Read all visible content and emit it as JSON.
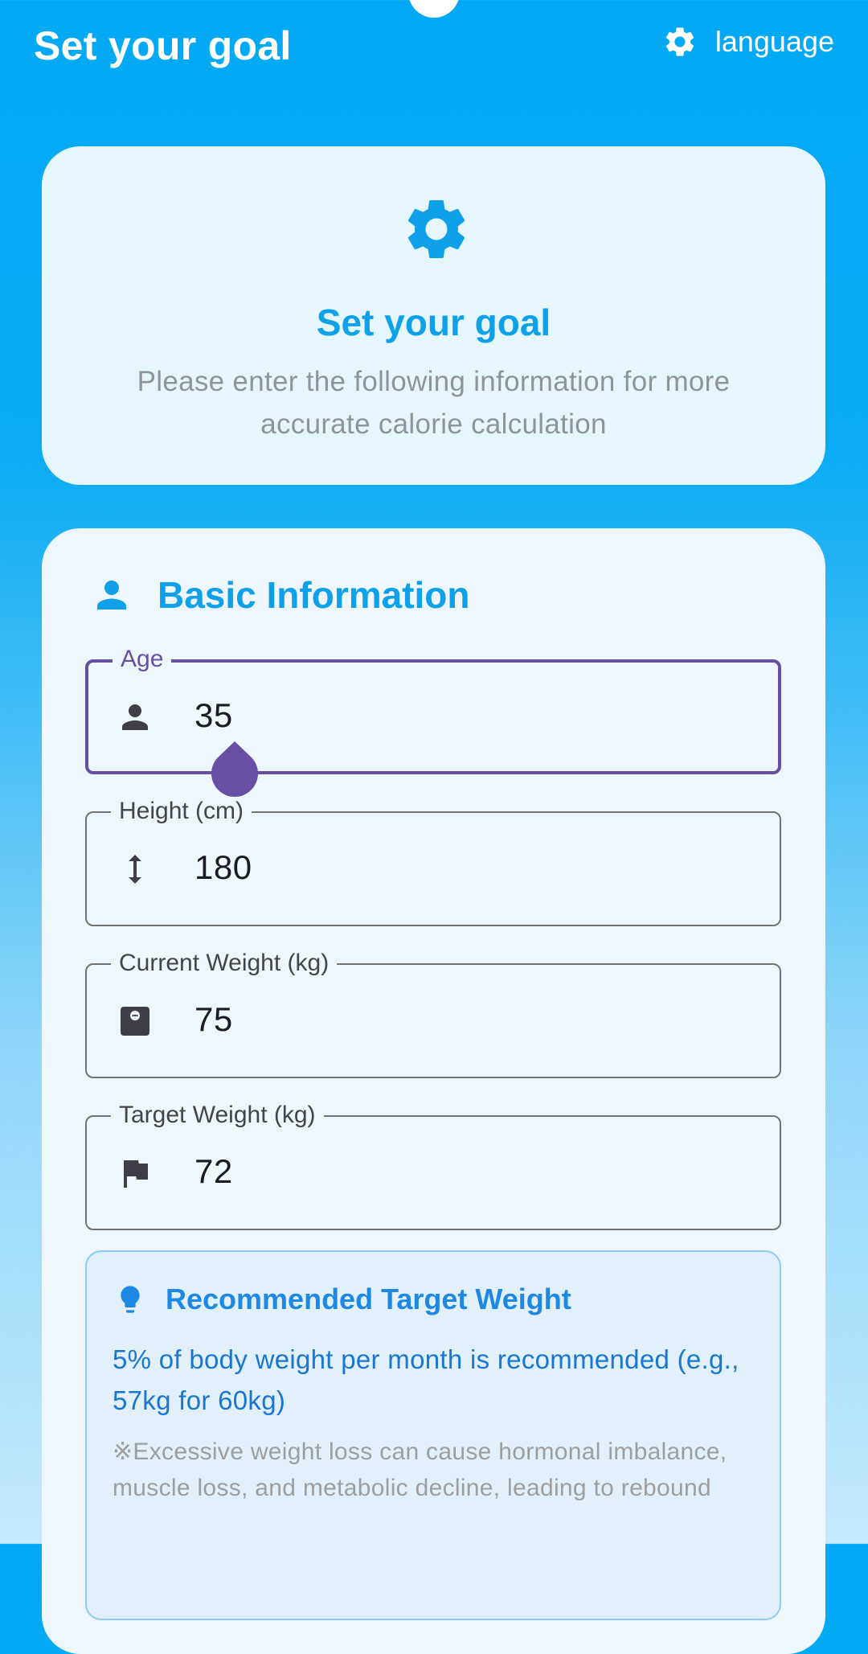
{
  "appbar": {
    "title": "Set your goal",
    "language_label": "language",
    "language_icon": "gear-icon"
  },
  "header_card": {
    "icon": "gear-icon",
    "title": "Set your goal",
    "subtitle": "Please enter the following information for more accurate calorie calculation"
  },
  "basic_info": {
    "title": "Basic Information",
    "icon": "person-icon",
    "fields": [
      {
        "label": "Age",
        "value": "35",
        "icon": "person-icon",
        "focused": true
      },
      {
        "label": "Height (cm)",
        "value": "180",
        "icon": "height-arrow-icon"
      },
      {
        "label": "Current Weight (kg)",
        "value": "75",
        "icon": "scale-icon"
      },
      {
        "label": "Target Weight (kg)",
        "value": "72",
        "icon": "flag-icon"
      }
    ]
  },
  "recommendation": {
    "icon": "lightbulb-icon",
    "title": "Recommended Target Weight",
    "text": "5% of body weight per month is recommended (e.g., 57kg for 60kg)",
    "warning": "※Excessive weight loss can cause hormonal imbalance, muscle loss, and metabolic decline, leading to rebound"
  },
  "colors": {
    "primary": "#03A9F4",
    "accent_title": "#0EA1EA",
    "focus": "#6750A4",
    "recommend_text": "#1976D2"
  }
}
